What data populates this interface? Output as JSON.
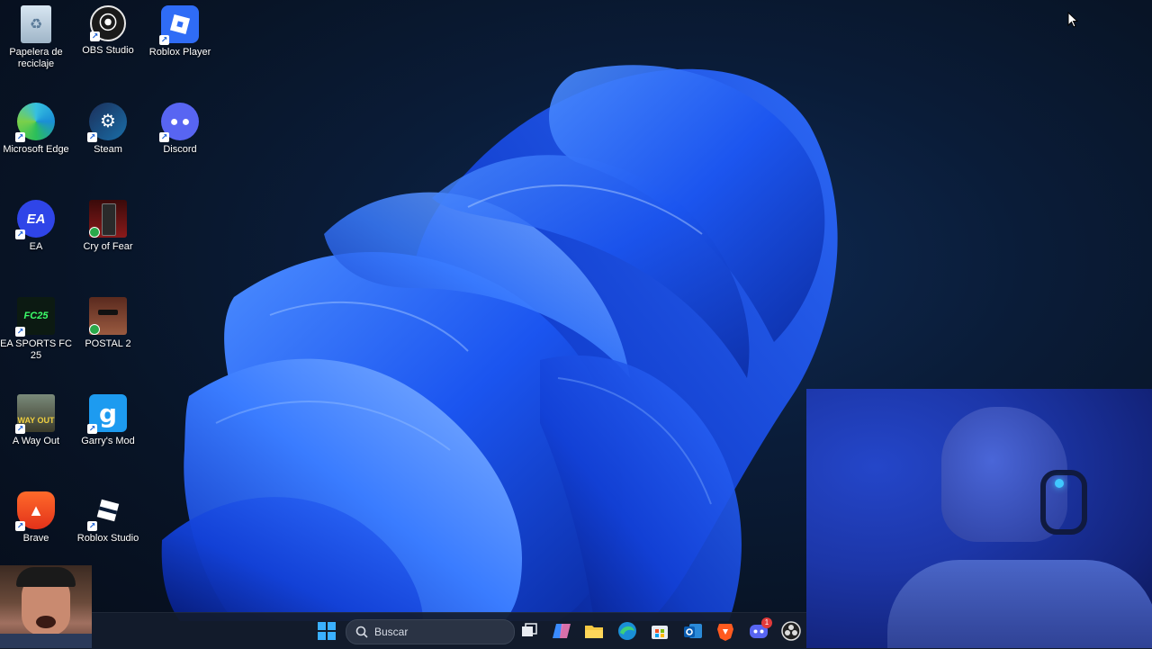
{
  "desktop": {
    "icons": [
      {
        "label": "Papelera de reciclaje",
        "icon": "recycle-bin-icon"
      },
      {
        "label": "OBS Studio",
        "icon": "obs-icon"
      },
      {
        "label": "Roblox Player",
        "icon": "roblox-icon"
      },
      {
        "label": "Microsoft Edge",
        "icon": "edge-icon"
      },
      {
        "label": "Steam",
        "icon": "steam-icon"
      },
      {
        "label": "Discord",
        "icon": "discord-icon"
      },
      {
        "label": "EA",
        "icon": "ea-icon"
      },
      {
        "label": "Cry of Fear",
        "icon": "cry-of-fear-icon"
      },
      {
        "label": "EA SPORTS FC 25",
        "icon": "fc25-icon"
      },
      {
        "label": "POSTAL 2",
        "icon": "postal2-icon"
      },
      {
        "label": "A Way Out",
        "icon": "a-way-out-icon"
      },
      {
        "label": "Garry's Mod",
        "icon": "garrys-mod-icon"
      },
      {
        "label": "Brave",
        "icon": "brave-icon"
      },
      {
        "label": "Roblox Studio",
        "icon": "roblox-studio-icon"
      }
    ]
  },
  "taskbar": {
    "search_placeholder": "Buscar",
    "discord_badge": "1",
    "items": [
      "start-icon",
      "widget-icon",
      "task-view-icon",
      "copilot-icon",
      "file-explorer-icon",
      "edge-icon",
      "store-icon",
      "outlook-icon",
      "brave-icon",
      "discord-icon",
      "obs-icon"
    ]
  },
  "colors": {
    "accent": "#1f5bff",
    "taskbar": "#141c2c"
  }
}
